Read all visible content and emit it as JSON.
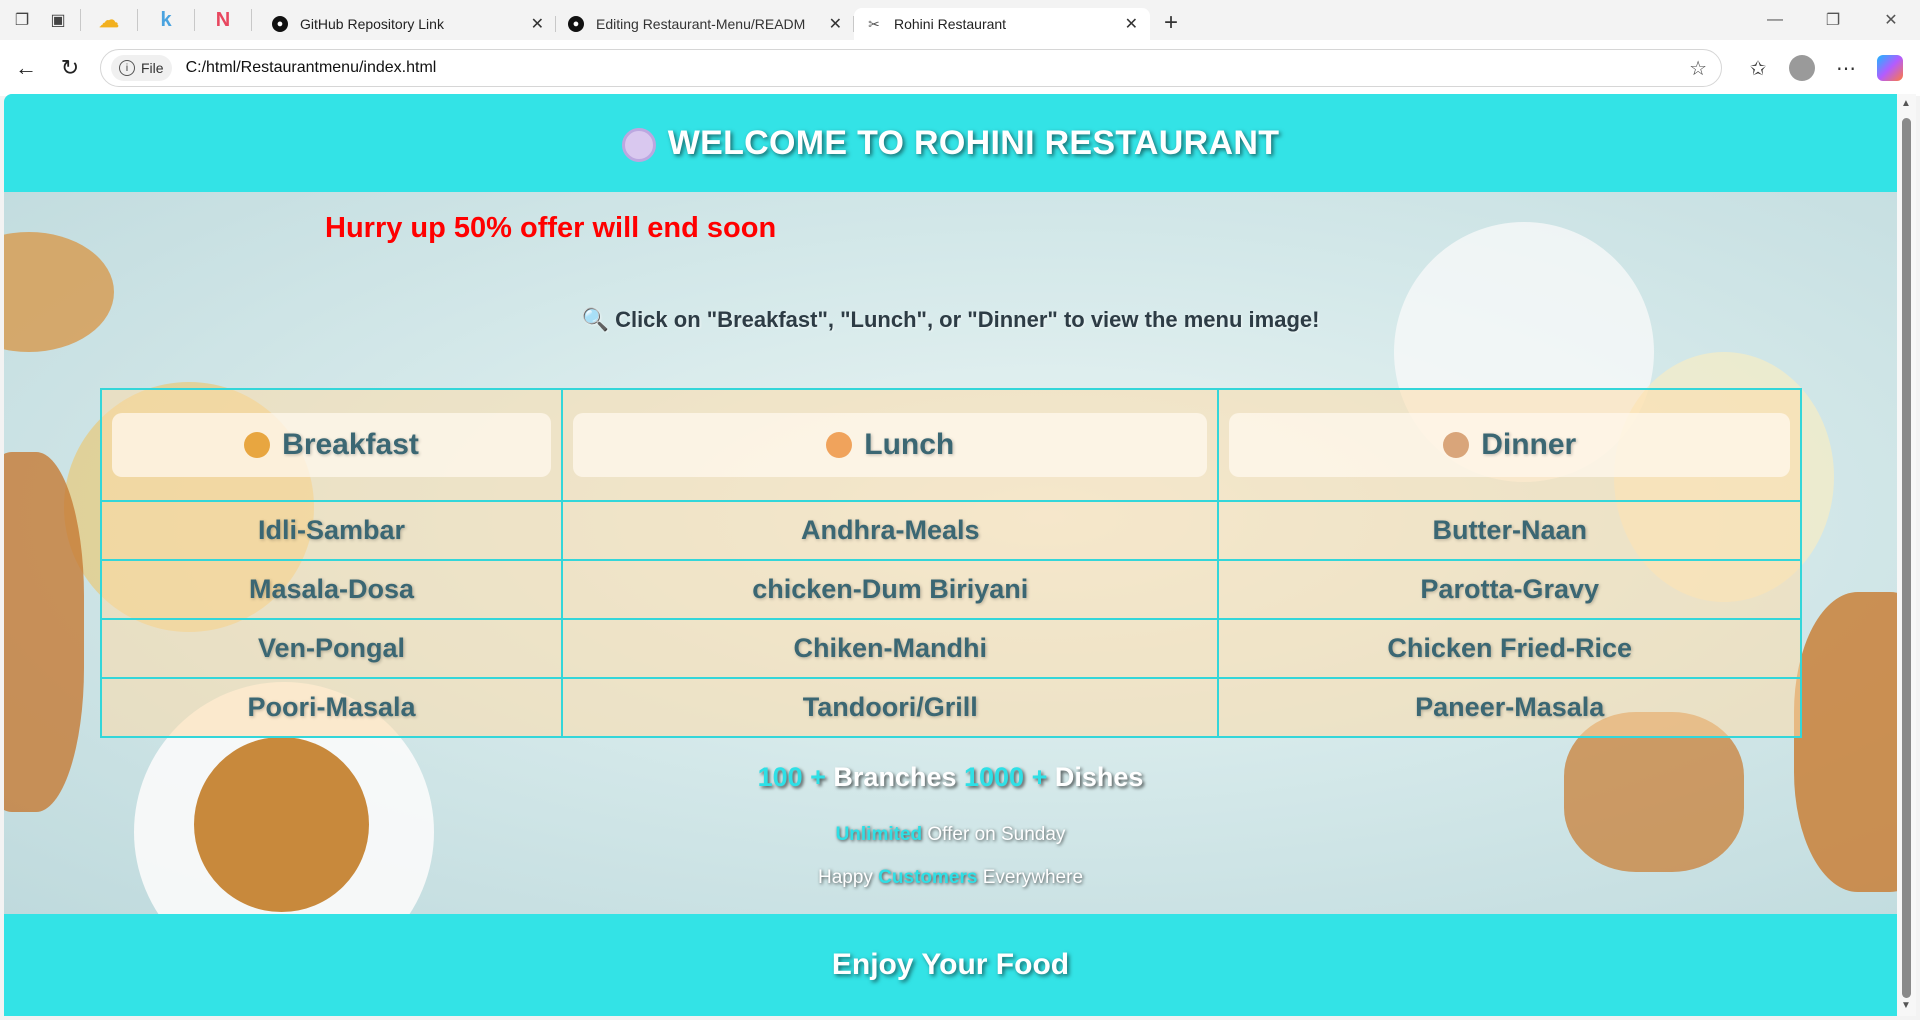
{
  "browser": {
    "tabs": [
      {
        "title": "GitHub Repository Link",
        "icon": "github-icon"
      },
      {
        "title": "Editing Restaurant-Menu/READM",
        "icon": "github-icon"
      },
      {
        "title": "Rohini Restaurant",
        "icon": "restaurant-icon"
      }
    ],
    "file_chip": "File",
    "url": "C:/html/Restaurantmenu/index.html"
  },
  "page": {
    "heading": "WELCOME TO ROHINI RESTAURANT",
    "offer": "Hurry up 50% offer will end soon",
    "hint": "Click on \"Breakfast\", \"Lunch\", or \"Dinner\" to view the menu image!",
    "menu": {
      "headers": [
        "Breakfast",
        "Lunch",
        "Dinner"
      ],
      "rows": [
        [
          "Idli-Sambar",
          "Andhra-Meals",
          "Butter-Naan"
        ],
        [
          "Masala-Dosa",
          "chicken-Dum Biriyani",
          "Parotta-Gravy"
        ],
        [
          "Ven-Pongal",
          "Chiken-Mandhi",
          "Chicken Fried-Rice"
        ],
        [
          "Poori-Masala",
          "Tandoori/Grill",
          "Paneer-Masala"
        ]
      ]
    },
    "stats": {
      "branches_num": "100 +",
      "branches_label": "Branches",
      "dishes_num": "1000 +",
      "dishes_label": "Dishes"
    },
    "line2": {
      "highlight": "Unlimited",
      "rest": "Offer on Sunday"
    },
    "line3": {
      "pre": "Happy",
      "highlight": "Customers",
      "post": "Everywhere"
    },
    "footer": "Enjoy Your Food"
  },
  "colors": {
    "accent": "#33e3e6",
    "offer": "#ff0000",
    "menu_text": "#3b6773"
  }
}
